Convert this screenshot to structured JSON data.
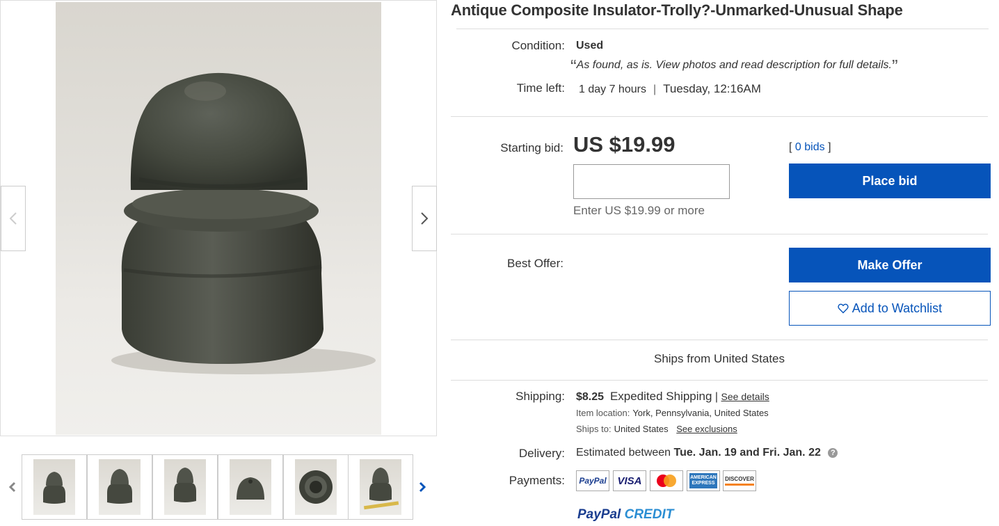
{
  "listing": {
    "title": "Antique Composite Insulator-Trolly?-Unmarked-Unusual Shape"
  },
  "condition": {
    "label": "Condition:",
    "value": "Used",
    "note": "As found, as is. View photos and read description for full details."
  },
  "time_left": {
    "label": "Time left:",
    "remaining": "1 day 7 hours",
    "separator": "|",
    "end_time": "Tuesday, 12:16AM"
  },
  "bid": {
    "label": "Starting bid:",
    "price": "US $19.99",
    "input_value": "",
    "hint": "Enter US $19.99 or more",
    "bids_open": "[",
    "bids_count": "0 bids",
    "bids_close": "]",
    "place_bid_label": "Place bid"
  },
  "best_offer": {
    "label": "Best Offer:",
    "make_offer_label": "Make Offer",
    "watchlist_label": "Add to Watchlist"
  },
  "ships_from": "Ships from United States",
  "shipping": {
    "label": "Shipping:",
    "cost": "$8.25",
    "service": "Expedited Shipping",
    "pipe": "|",
    "see_details": "See details",
    "item_location_label": "Item location:",
    "item_location": "York, Pennsylvania, United States",
    "ships_to_label": "Ships to:",
    "ships_to": "United States",
    "see_exclusions": "See exclusions"
  },
  "delivery": {
    "label": "Delivery:",
    "prefix": "Estimated between",
    "range": "Tue. Jan. 19 and Fri. Jan. 22"
  },
  "payments": {
    "label": "Payments:",
    "methods": [
      "PayPal",
      "VISA",
      "Mastercard",
      "American Express",
      "Discover"
    ],
    "paypal_credit_a": "PayPal",
    "paypal_credit_b": "CREDIT"
  },
  "icons": {
    "prev": "chevron-left-icon",
    "next": "chevron-right-icon",
    "heart": "heart-icon",
    "help": "help-icon"
  },
  "colors": {
    "brand_blue": "#0654ba",
    "text": "#333333",
    "divider": "#dddddd"
  }
}
